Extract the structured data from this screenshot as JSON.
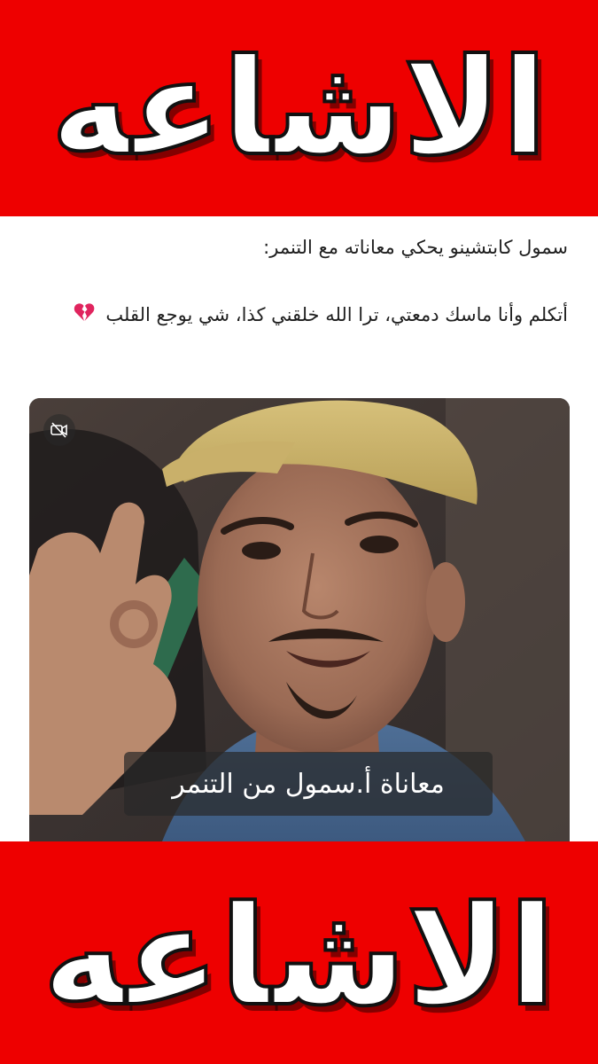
{
  "banner_top": {
    "text": "الاشاعه"
  },
  "banner_bottom": {
    "text": "الاشاعه"
  },
  "post": {
    "headline": "سمول كابتشينو يحكي معاناته مع التنمر:",
    "body": "أتكلم وأنا ماسك دمعتي، ترا الله خلقني كذا، شي يوجع القلب",
    "emoji_icon": "broken-heart-icon"
  },
  "video": {
    "caption": "معاناة أ.سمول من التنمر",
    "mute_icon": "muted-video-icon"
  },
  "colors": {
    "banner_red": "#ee0000",
    "text": "#1f1f1f",
    "heart": "#e0245e"
  }
}
